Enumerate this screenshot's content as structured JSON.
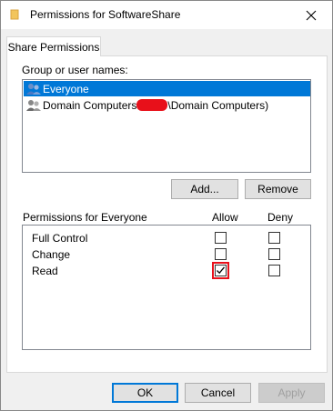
{
  "window": {
    "title": "Permissions for SoftwareShare"
  },
  "tabs": [
    {
      "label": "Share Permissions",
      "active": true
    }
  ],
  "group_section": {
    "label": "Group or user names:",
    "users": [
      {
        "name": "Everyone",
        "selected": true
      },
      {
        "name_prefix": "Domain Computers",
        "name_suffix": "\\Domain Computers)",
        "redacted": true,
        "selected": false
      }
    ]
  },
  "buttons": {
    "add": "Add...",
    "remove": "Remove",
    "ok": "OK",
    "cancel": "Cancel",
    "apply": "Apply"
  },
  "permissions": {
    "header": "Permissions for Everyone",
    "allow_header": "Allow",
    "deny_header": "Deny",
    "rows": [
      {
        "name": "Full Control",
        "allow": false,
        "deny": false
      },
      {
        "name": "Change",
        "allow": false,
        "deny": false
      },
      {
        "name": "Read",
        "allow": true,
        "deny": false,
        "highlighted": true
      }
    ]
  },
  "colors": {
    "selection": "#0078d7",
    "highlight": "#e8101a",
    "redaction": "#e8101a"
  },
  "icons": {
    "title": "folder-icon",
    "close": "close-icon",
    "user": "users-group-icon",
    "computer": "domain-computers-icon"
  }
}
